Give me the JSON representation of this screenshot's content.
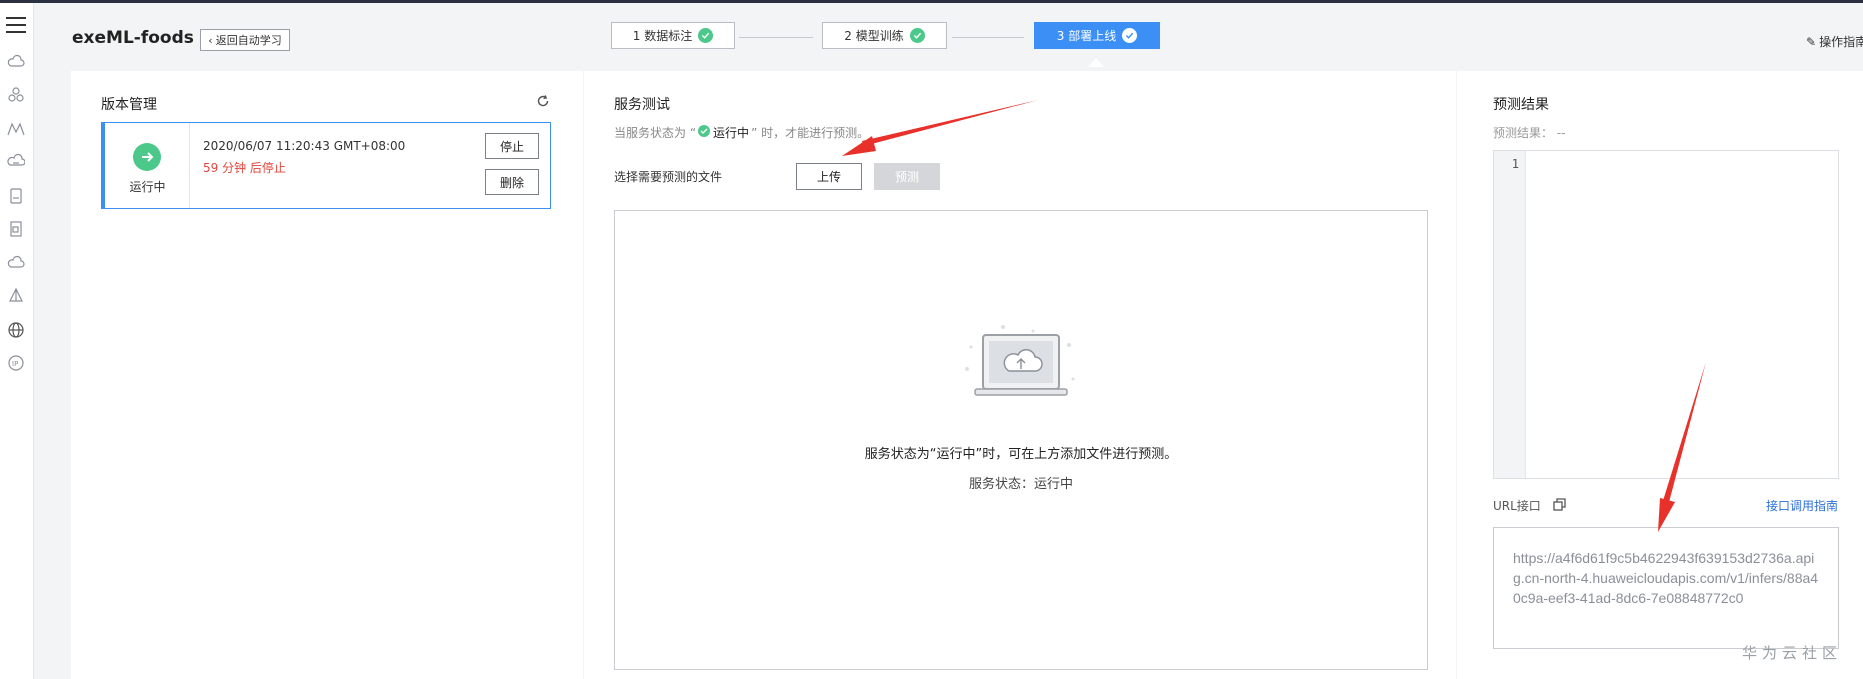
{
  "header": {
    "app_title": "exeML-foods",
    "back_button": "返回自动学习",
    "steps": [
      {
        "label": "1 数据标注",
        "state": "done"
      },
      {
        "label": "2 模型训练",
        "state": "done"
      },
      {
        "label": "3 部署上线",
        "state": "active"
      }
    ],
    "guide_link": "操作指南"
  },
  "rail": {
    "icons": [
      "cloud-icon",
      "cluster-icon",
      "mountain-icon",
      "cloud-server-icon",
      "storage-icon",
      "document-icon",
      "cloud-outline-icon",
      "network-icon",
      "globe-icon",
      "ip-icon"
    ]
  },
  "version": {
    "title": "版本管理",
    "status_label": "运行中",
    "datetime": "2020/06/07 11:20:43 GMT+08:00",
    "stop_note": "59 分钟 后停止",
    "stop_button": "停止",
    "delete_button": "删除"
  },
  "service_test": {
    "title": "服务测试",
    "hint_prefix": "当服务状态为 “",
    "hint_status": "运行中",
    "hint_suffix": "” 时，才能进行预测。",
    "file_label": "选择需要预测的文件",
    "upload_button": "上传",
    "predict_button": "预测",
    "drop_message": "服务状态为“运行中”时，可在上方添加文件进行预测。",
    "service_status": "服务状态：运行中"
  },
  "result": {
    "title": "预测结果",
    "label": "预测结果：  --",
    "line_number": "1",
    "url_label": "URL接口",
    "api_guide": "接口调用指南",
    "url": "https://a4f6d61f9c5b4622943f639153d2736a.apig.cn-north-4.huaweicloudapis.com/v1/infers/88a40c9a-eef3-41ad-8dc6-7e08848772c0"
  },
  "watermark": "华为云社区",
  "colors": {
    "accent": "#3b8ff5",
    "success": "#4bc88a",
    "danger": "#e0463d",
    "arrow": "#e8312a"
  }
}
